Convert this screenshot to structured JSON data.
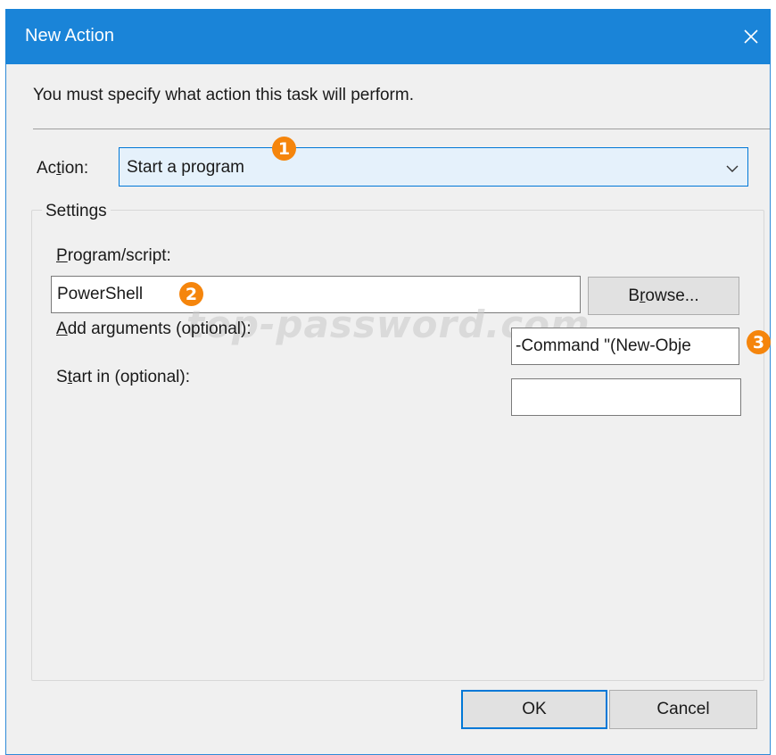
{
  "window": {
    "title": "New Action",
    "close_icon": "close-icon",
    "accent_color": "#1a84d8"
  },
  "instruction": "You must specify what action this task will perform.",
  "action": {
    "label_before": "Ac",
    "label_mnemonic": "t",
    "label_after": "ion:",
    "selected_value": "Start a program",
    "badge": "1"
  },
  "settings": {
    "group_label": "Settings",
    "program": {
      "label_mnemonic": "P",
      "label_rest": "rogram/script:",
      "value": "PowerShell",
      "badge": "2"
    },
    "browse": {
      "label_before": "B",
      "label_mnemonic": "r",
      "label_after": "owse..."
    },
    "arguments": {
      "label_mnemonic": "A",
      "label_rest": "dd arguments (optional):",
      "value": "-Command \"(New-Obje",
      "badge": "3"
    },
    "start_in": {
      "label_before": "S",
      "label_mnemonic": "t",
      "label_after": "art in (optional):",
      "value": ""
    }
  },
  "watermark": "top-password.com",
  "buttons": {
    "ok": "OK",
    "cancel": "Cancel"
  },
  "badge_color": "#f5850c"
}
